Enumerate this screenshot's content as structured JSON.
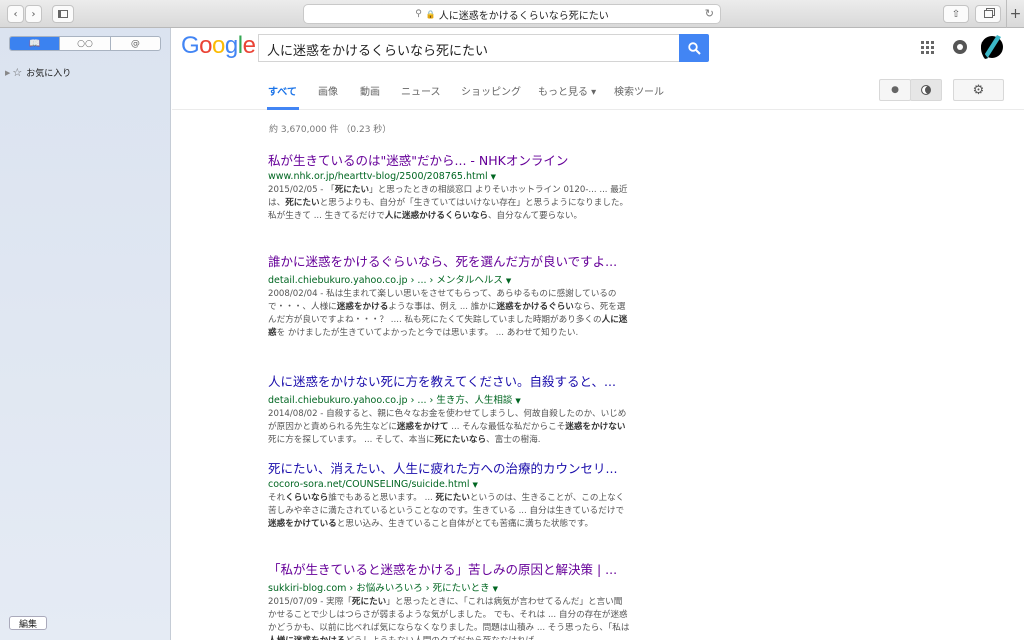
{
  "browser": {
    "address": "人に迷惑をかけるくらいなら死にたい",
    "new_tab": "+"
  },
  "sidebar": {
    "favorites_label": "お気に入り",
    "edit_label": "編集"
  },
  "google": {
    "logo_letters": [
      "G",
      "o",
      "o",
      "g",
      "l",
      "e"
    ],
    "logo_colors": [
      "#4285f4",
      "#ea4335",
      "#fbbc05",
      "#4285f4",
      "#34a853",
      "#ea4335"
    ],
    "query": "人に迷惑をかけるくらいなら死にたい",
    "tabs": [
      "すべて",
      "画像",
      "動画",
      "ニュース",
      "ショッピング",
      "もっと見る ▾",
      "検索ツール"
    ],
    "stats": "約 3,670,000 件 （0.23 秒）"
  },
  "results": [
    {
      "title": "私が生きているのは\"迷惑\"だから... - NHKオンライン",
      "url": "www.nhk.or.jp/hearttv-blog/2500/208765.html",
      "snippet": [
        "2015/02/05 - 「",
        {
          "b": "死にたい"
        },
        "」と思ったときの相談窓口 よりそいホットライン 0120-... ... 最近は、",
        {
          "b": "死にたい"
        },
        "と思うよりも、自分が「生きていてはいけない存在」と思うようになりました。私が生きて ... 生きてるだけで",
        {
          "b": "人に迷惑かけるくらいなら"
        },
        "、自分なんて要らない。"
      ]
    },
    {
      "title": "誰かに迷惑をかけるぐらいなら、死を選んだ方が良いですよ...",
      "url": "detail.chiebukuro.yahoo.co.jp › ... › メンタルヘルス",
      "snippet": [
        "2008/02/04 - 私は生まれて楽しい思いをさせてもらって、あらゆるものに感謝しているので・・・、人様に",
        {
          "b": "迷惑をかける"
        },
        "ような事は、例え ... 誰かに",
        {
          "b": "迷惑をかけるぐらい"
        },
        "なら、死を選んだ方が良いですよね・・・？ .... 私も死にたくて失踪していました時期があり多くの",
        {
          "b": "人に迷惑"
        },
        "を かけましたが生きていてよかったと今では思います。 ... あわせて知りたい."
      ]
    },
    {
      "title": "人に迷惑をかけない死に方を教えてください。自殺すると、...",
      "url": "detail.chiebukuro.yahoo.co.jp › ... › 生き方、人生相談",
      "snippet": [
        "2014/08/02 - 自殺すると、親に色々なお金を使わせてしまうし、何故自殺したのか、いじめが原因かと責められる先生などに",
        {
          "b": "迷惑をかけて"
        },
        " ... そんな最低な私だからこそ",
        {
          "b": "迷惑をかけない"
        },
        "死に方を探しています。 ... そして、本当に",
        {
          "b": "死にたいなら"
        },
        "、富士の樹海."
      ]
    },
    {
      "title": "死にたい、消えたい、人生に疲れた方への治療的カウンセリ...",
      "url": "cocoro-sora.net/COUNSELING/suicide.html",
      "snippet": [
        "それ",
        {
          "b": "くらいなら"
        },
        "誰でもあると思います。 ... ",
        {
          "b": "死にたい"
        },
        "というのは、生きることが、この上なく苦しみや辛さに満たされているということなのです。生きている ... 自分は生きているだけで",
        {
          "b": "迷惑をかけている"
        },
        "と思い込み、生きていること自体がとても苦痛に満ちた状態です。"
      ]
    },
    {
      "title": "「私が生きていると迷惑をかける」苦しみの原因と解決策 | ...",
      "url": "sukkiri-blog.com › お悩みいろいろ › 死にたいとき",
      "snippet": [
        "2015/07/09 - 実際「",
        {
          "b": "死にたい"
        },
        "」と思ったときに、「これは病気が言わせてるんだ」と言い聞かせることで少しはつらさが弱まるような気がしました。 でも、それは ... 自分の存在が迷惑かどうかも、以前に比べれば気にならなくなりました。問題は山積み ... そう思ったら、「私は",
        {
          "b": "人様に迷惑をかける"
        },
        "どうしようもない人間のクズだから死ななければ..."
      ]
    }
  ]
}
